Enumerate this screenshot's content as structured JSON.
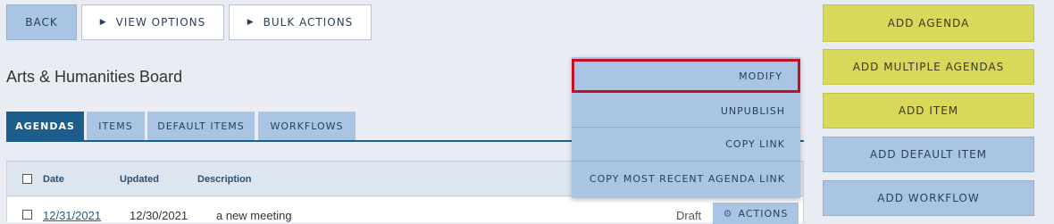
{
  "toolbar": {
    "back_label": "BACK",
    "view_options_label": "VIEW OPTIONS",
    "bulk_actions_label": "BULK ACTIONS",
    "triangle_glyph": "▶"
  },
  "page_title": "Arts & Humanities Board",
  "tabs": [
    {
      "label": "AGENDAS",
      "active": true
    },
    {
      "label": "ITEMS",
      "active": false
    },
    {
      "label": "DEFAULT ITEMS",
      "active": false
    },
    {
      "label": "WORKFLOWS",
      "active": false
    }
  ],
  "table": {
    "headers": [
      "Date",
      "Updated",
      "Description"
    ],
    "rows": [
      {
        "date": "12/31/2021",
        "updated": "12/30/2021",
        "description": "a new meeting",
        "status": "Draft",
        "actions_label": "ACTIONS"
      }
    ]
  },
  "dropdown_menu": {
    "items": [
      "MODIFY",
      "UNPUBLISH",
      "COPY LINK",
      "COPY MOST RECENT AGENDA LINK"
    ],
    "highlighted_item": "MODIFY"
  },
  "side_actions": [
    {
      "label": "ADD AGENDA",
      "color": "#d8d85a"
    },
    {
      "label": "ADD MULTIPLE AGENDAS",
      "color": "#d8d85a"
    },
    {
      "label": "ADD ITEM",
      "color": "#d8d85a"
    },
    {
      "label": "ADD DEFAULT ITEM",
      "color": "#a9c5e3"
    },
    {
      "label": "ADD WORKFLOW",
      "color": "#a9c5e3"
    }
  ],
  "icons": {
    "gear": "gear-icon",
    "gear_glyph": "⚙"
  },
  "colors": {
    "accent_blue": "#1d5d8b",
    "light_blue": "#a9c5e3",
    "yellow": "#d8d85a",
    "highlight_red": "#c0102a"
  }
}
